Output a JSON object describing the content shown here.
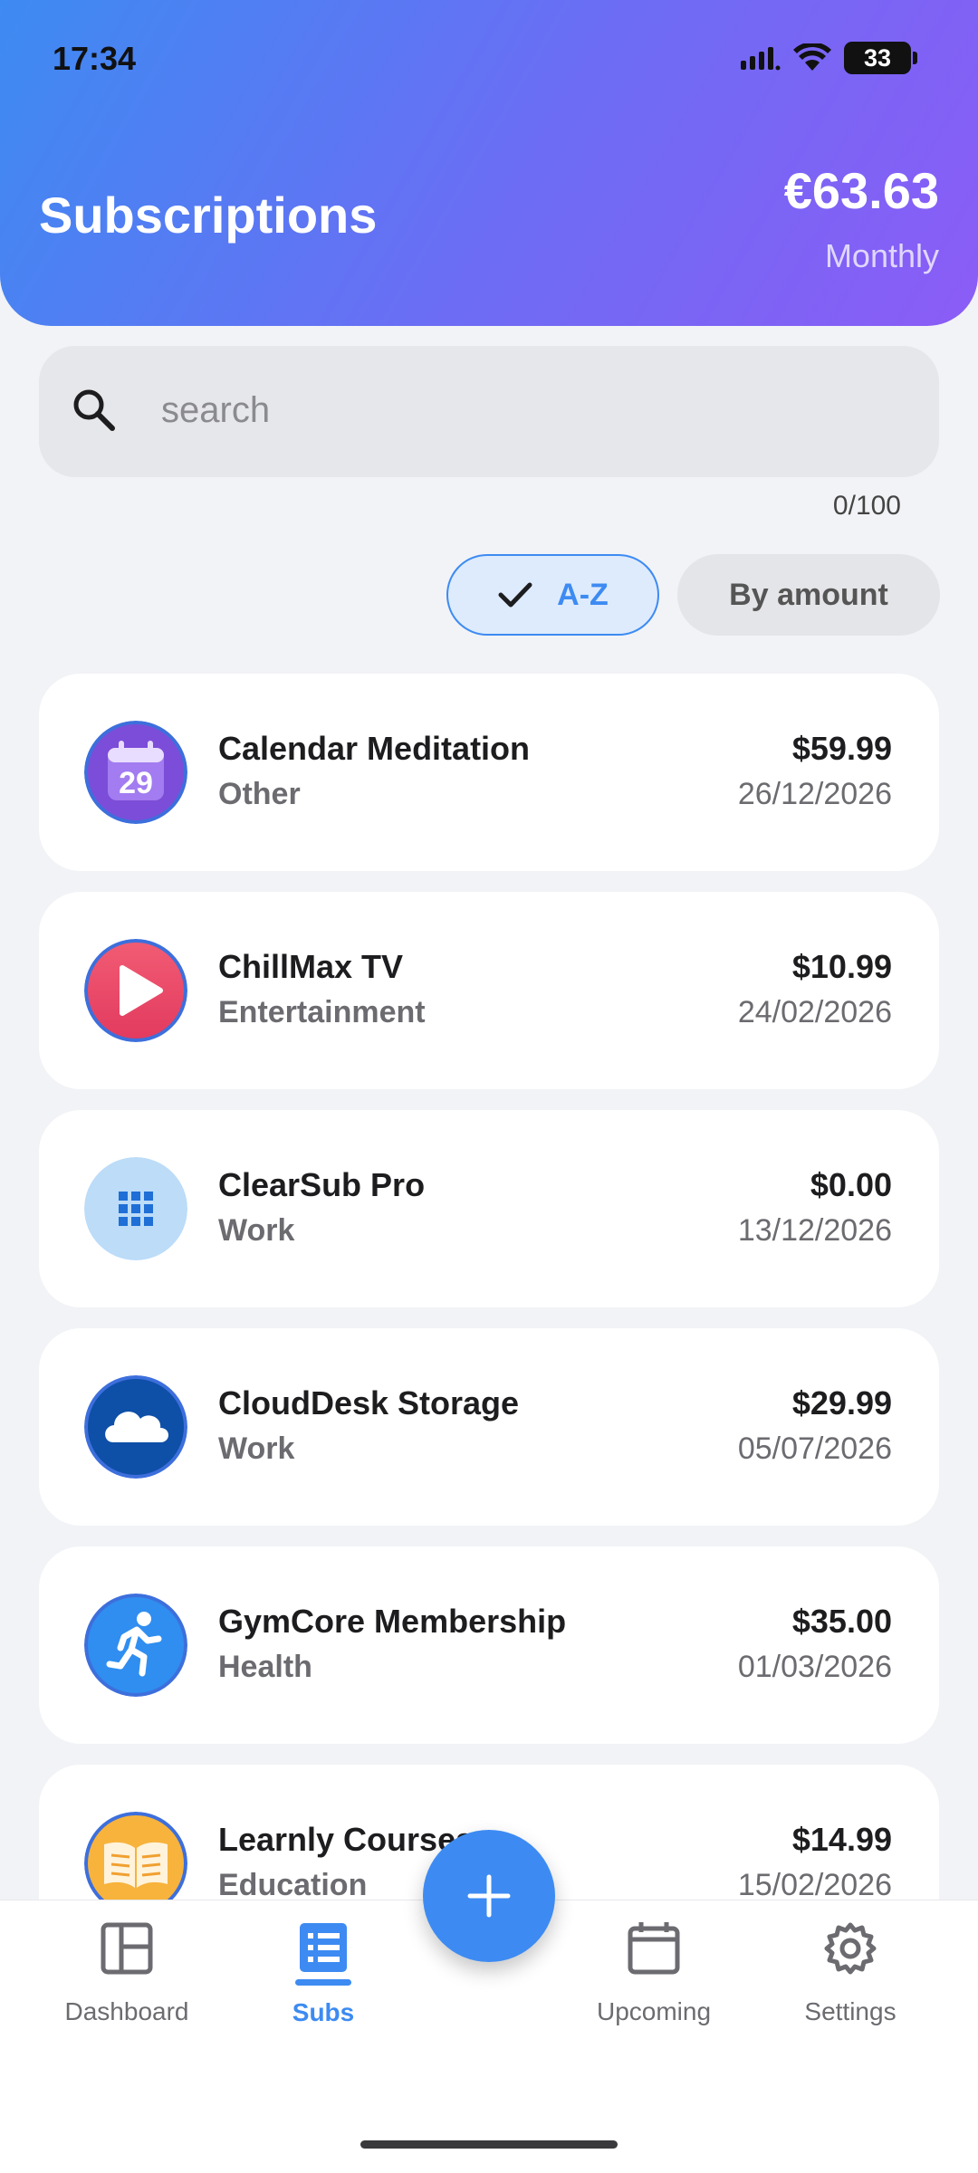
{
  "status_bar": {
    "time": "17:34",
    "battery": "33"
  },
  "header": {
    "title": "Subscriptions",
    "total": "€63.63",
    "period": "Monthly"
  },
  "search": {
    "placeholder": "search",
    "value": "",
    "counter": "0/100"
  },
  "sort": {
    "az_label": "A-Z",
    "amount_label": "By amount",
    "selected": "A-Z"
  },
  "subscriptions": [
    {
      "name": "Calendar Meditation",
      "category": "Other",
      "price": "$59.99",
      "date": "26/12/2026",
      "icon": "calendar-icon"
    },
    {
      "name": "ChillMax TV",
      "category": "Entertainment",
      "price": "$10.99",
      "date": "24/02/2026",
      "icon": "play-icon"
    },
    {
      "name": "ClearSub Pro",
      "category": "Work",
      "price": "$0.00",
      "date": "13/12/2026",
      "icon": "grid-icon"
    },
    {
      "name": "CloudDesk Storage",
      "category": "Work",
      "price": "$29.99",
      "date": "05/07/2026",
      "icon": "cloud-icon"
    },
    {
      "name": "GymCore Membership",
      "category": "Health",
      "price": "$35.00",
      "date": "01/03/2026",
      "icon": "running-icon"
    },
    {
      "name": "Learnly Courses",
      "category": "Education",
      "price": "$14.99",
      "date": "15/02/2026",
      "icon": "book-icon"
    }
  ],
  "icons": {
    "calendar_day": "29"
  },
  "nav": {
    "items": [
      {
        "label": "Dashboard",
        "icon": "dashboard-icon"
      },
      {
        "label": "Subs",
        "icon": "list-icon",
        "active": true
      },
      {
        "label": "Upcoming",
        "icon": "calendar-outline-icon"
      },
      {
        "label": "Settings",
        "icon": "gear-icon"
      }
    ],
    "fab_icon": "plus-icon"
  },
  "colors": {
    "accent": "#3d8bf2",
    "gradient_start": "#3d8bf2",
    "gradient_end": "#8b5cf6"
  }
}
